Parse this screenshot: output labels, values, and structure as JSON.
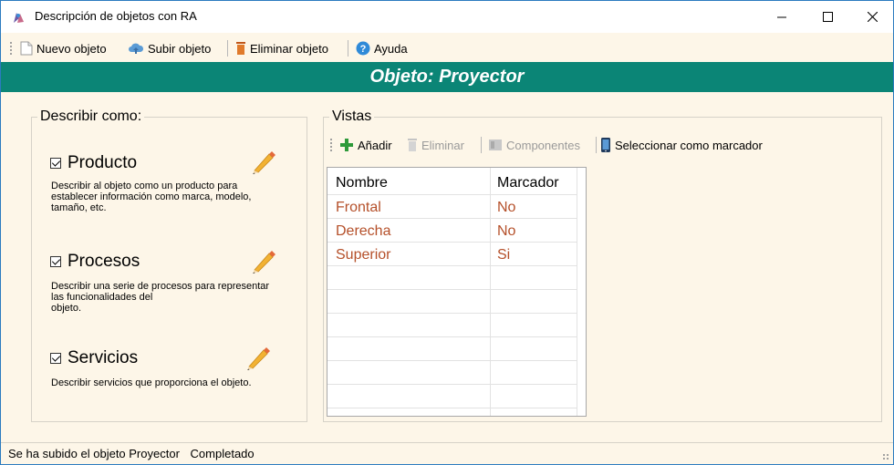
{
  "window": {
    "title": "Descripción de objetos con RA",
    "controls": {
      "minimize": "—",
      "maximize": "☐",
      "close": "✕"
    }
  },
  "toolbar": {
    "items": [
      {
        "label": "Nuevo objeto",
        "icon": "new-document-icon"
      },
      {
        "label": "Subir objeto",
        "icon": "cloud-upload-icon"
      },
      {
        "label": "Eliminar objeto",
        "icon": "trash-icon"
      },
      {
        "label": "Ayuda",
        "icon": "help-icon"
      }
    ]
  },
  "banner": {
    "title": "Objeto: Proyector",
    "color": "#0b8576"
  },
  "describe": {
    "legend": "Describir como:",
    "options": [
      {
        "label": "Producto",
        "checked": true,
        "description_lines": [
          "Describir al objeto como un producto para",
          "establecer información como marca, modelo,",
          "tamaño, etc."
        ]
      },
      {
        "label": "Procesos",
        "checked": true,
        "description_lines": [
          "Describir una serie de procesos para representar",
          "las funcionalidades del",
          "objeto."
        ]
      },
      {
        "label": "Servicios",
        "checked": true,
        "description_lines": [
          "Describir servicios que proporciona el objeto."
        ]
      }
    ]
  },
  "views": {
    "legend": "Vistas",
    "toolbar": [
      {
        "label": "Añadir",
        "icon": "add-icon",
        "enabled": true
      },
      {
        "label": "Eliminar",
        "icon": "trash-icon",
        "enabled": false
      },
      {
        "label": "Componentes",
        "icon": "components-icon",
        "enabled": false
      },
      {
        "label": "Seleccionar como marcador",
        "icon": "phone-marker-icon",
        "enabled": true
      }
    ],
    "columns": [
      "Nombre",
      "Marcador"
    ],
    "rows": [
      [
        "Frontal",
        "No"
      ],
      [
        "Derecha",
        "No"
      ],
      [
        "Superior",
        "Si"
      ]
    ],
    "value_color": "#b5502a"
  },
  "status": {
    "message": "Se ha subido el objeto Proyector",
    "state": "Completado"
  }
}
